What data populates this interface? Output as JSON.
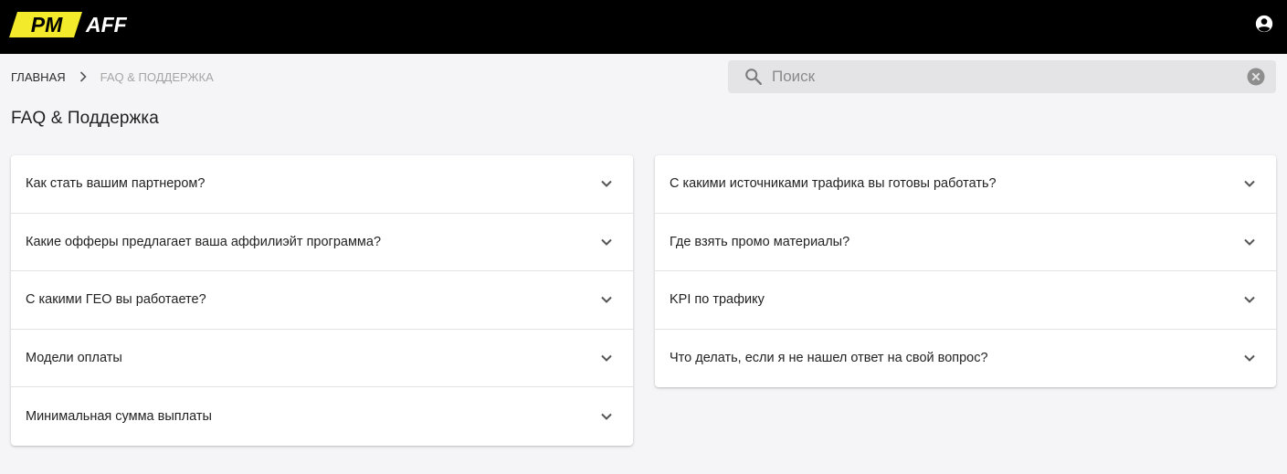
{
  "header": {
    "logo_pm": "PM",
    "logo_aff": "AFF",
    "account_icon": "account-circle-icon",
    "bg_color": "#000000",
    "logo_color": "#f2ea2a"
  },
  "breadcrumb": {
    "home": "Главная",
    "current": "FAQ & Поддержка"
  },
  "search": {
    "placeholder": "Поиск",
    "value": ""
  },
  "page": {
    "title": "FAQ & Поддержка"
  },
  "faq": {
    "left": [
      {
        "question": "Как стать вашим партнером?"
      },
      {
        "question": "Какие офферы предлагает ваша аффилиэйт программа?"
      },
      {
        "question": "С какими ГЕО вы работаете?"
      },
      {
        "question": "Модели оплаты"
      },
      {
        "question": "Минимальная сумма выплаты"
      }
    ],
    "right": [
      {
        "question": "С какими источниками трафика вы готовы работать?"
      },
      {
        "question": "Где взять промо материалы?"
      },
      {
        "question": "KPI по трафику"
      },
      {
        "question": "Что делать, если я не нашел ответ на свой вопрос?"
      }
    ]
  }
}
